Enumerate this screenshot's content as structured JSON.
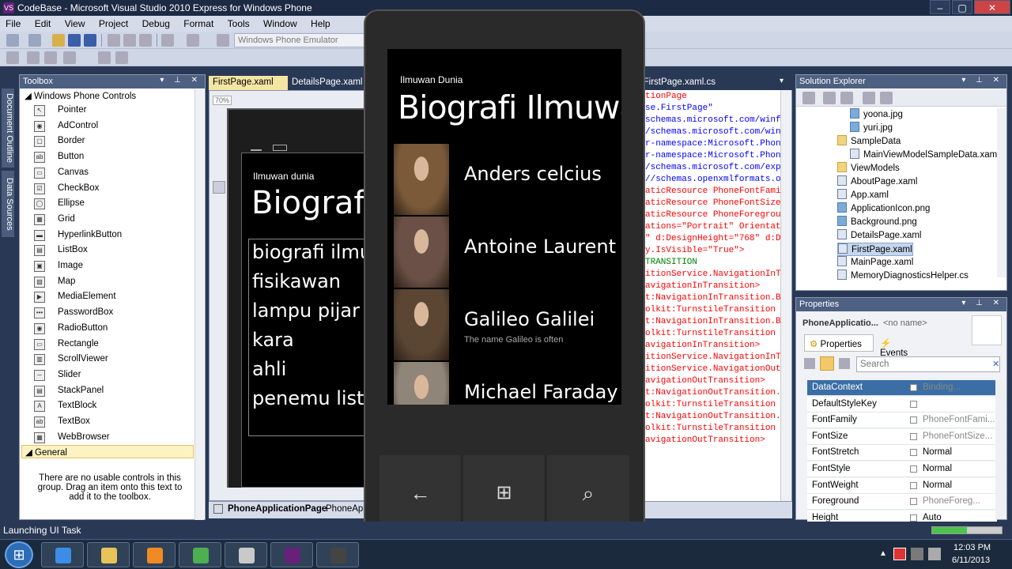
{
  "window": {
    "title": "CodeBase - Microsoft Visual Studio 2010 Express for Windows Phone",
    "app_icon": "visual-studio-icon"
  },
  "menu": [
    "File",
    "Edit",
    "View",
    "Project",
    "Debug",
    "Format",
    "Tools",
    "Window",
    "Help"
  ],
  "toolbar": {
    "target_device": "Windows Phone Emulator"
  },
  "left_tabs": [
    "Document Outline",
    "Data Sources"
  ],
  "toolbox": {
    "title": "Toolbox",
    "group_controls": "Windows Phone Controls",
    "items": [
      "Pointer",
      "AdControl",
      "Border",
      "Button",
      "Canvas",
      "CheckBox",
      "Ellipse",
      "Grid",
      "HyperlinkButton",
      "ListBox",
      "Image",
      "Map",
      "MediaElement",
      "PasswordBox",
      "RadioButton",
      "Rectangle",
      "ScrollViewer",
      "Slider",
      "StackPanel",
      "TextBlock",
      "TextBox",
      "WebBrowser"
    ],
    "group_general": "General",
    "general_empty_text": "There are no usable controls in this group. Drag an item onto this text to add it to the toolbox."
  },
  "doc_tabs": [
    "FirstPage.xaml",
    "DetailsPage.xaml",
    "FirstPage.xaml.cs"
  ],
  "designer": {
    "zoom": "70%",
    "app_title": "Ilmuwan dunia",
    "page_title": "Biografi",
    "list": [
      "biografi ilmu",
      "fisikawan",
      "lampu pijar",
      "kara",
      "ahli",
      "penemu list"
    ],
    "breadcrumb_root": "PhoneApplicationPage",
    "breadcrumb_next": "PhoneApp"
  },
  "xaml_lines": [
    {
      "t": "tionPage",
      "c": "red"
    },
    {
      "t": "se.FirstPage\"",
      "c": "blue"
    },
    {
      "t": "schemas.microsoft.com/winfx/",
      "c": "blue"
    },
    {
      "t": "/schemas.microsoft.com/winf",
      "c": "blue"
    },
    {
      "t": "r-namespace:Microsoft.Phone",
      "c": "blue"
    },
    {
      "t": "r-namespace:Microsoft.Phone",
      "c": "blue"
    },
    {
      "t": "/schemas.microsoft.com/exp",
      "c": "blue"
    },
    {
      "t": "//schemas.openxmlformats.o",
      "c": "blue"
    },
    {
      "t": "aticResource PhoneFontFami",
      "c": "red"
    },
    {
      "t": "aticResource PhoneFontSizeNo",
      "c": "red"
    },
    {
      "t": "aticResource PhoneForegrou",
      "c": "red"
    },
    {
      "t": "ations=\"Portrait\" Orientat",
      "c": "red"
    },
    {
      "t": "\" d:DesignHeight=\"768\" d:De",
      "c": "red"
    },
    {
      "t": "y.IsVisible=\"True\">",
      "c": "red"
    },
    {
      "t": " TRANSITION",
      "c": "green"
    },
    {
      "t": "itionService.NavigationInTra",
      "c": "red"
    },
    {
      "t": "avigationInTransition>",
      "c": "red"
    },
    {
      "t": "t:NavigationInTransition.Ba",
      "c": "red"
    },
    {
      "t": "olkit:TurnstileTransition M",
      "c": "red"
    },
    {
      "t": "t:NavigationInTransition.Ba",
      "c": "red"
    },
    {
      "t": "olkit:TurnstileTransition M",
      "c": "red"
    },
    {
      "t": "avigationInTransition>",
      "c": "red"
    },
    {
      "t": "itionService.NavigationInTra",
      "c": "red"
    },
    {
      "t": "itionService.NavigationOutTr",
      "c": "red"
    },
    {
      "t": "avigationOutTransition>",
      "c": "red"
    },
    {
      "t": "t:NavigationOutTransition.B",
      "c": "red"
    },
    {
      "t": "olkit:TurnstileTransition M",
      "c": "red"
    },
    {
      "t": "t:NavigationOutTransition.B",
      "c": "red"
    },
    {
      "t": "olkit:TurnstileTransition M",
      "c": "red"
    },
    {
      "t": "avigationOutTransition>",
      "c": "red"
    }
  ],
  "solution_explorer": {
    "title": "Solution Explorer",
    "items": [
      {
        "label": "yoona.jpg",
        "type": "img",
        "indent": 3
      },
      {
        "label": "yuri.jpg",
        "type": "img",
        "indent": 3
      },
      {
        "label": "SampleData",
        "type": "folder",
        "indent": 2
      },
      {
        "label": "MainViewModelSampleData.xaml",
        "type": "file",
        "indent": 3
      },
      {
        "label": "ViewModels",
        "type": "folder",
        "indent": 2
      },
      {
        "label": "AboutPage.xaml",
        "type": "file",
        "indent": 2
      },
      {
        "label": "App.xaml",
        "type": "file",
        "indent": 2
      },
      {
        "label": "ApplicationIcon.png",
        "type": "img",
        "indent": 2
      },
      {
        "label": "Background.png",
        "type": "img",
        "indent": 2
      },
      {
        "label": "DetailsPage.xaml",
        "type": "file",
        "indent": 2
      },
      {
        "label": "FirstPage.xaml",
        "type": "file",
        "indent": 2,
        "selected": true
      },
      {
        "label": "MainPage.xaml",
        "type": "file",
        "indent": 2
      },
      {
        "label": "MemoryDiagnosticsHelper.cs",
        "type": "file",
        "indent": 2
      }
    ]
  },
  "properties": {
    "title": "Properties",
    "object_type": "PhoneApplicatio...",
    "object_name": "<no name>",
    "tab_properties": "Properties",
    "tab_events": "Events",
    "search_placeholder": "Search",
    "rows": [
      {
        "name": "DataContext",
        "value": "Binding...",
        "selected": true
      },
      {
        "name": "DefaultStyleKey",
        "value": ""
      },
      {
        "name": "FontFamily",
        "value": "PhoneFontFami..."
      },
      {
        "name": "FontSize",
        "value": "PhoneFontSize..."
      },
      {
        "name": "FontStretch",
        "value": "Normal",
        "normal": true
      },
      {
        "name": "FontStyle",
        "value": "Normal",
        "normal": true
      },
      {
        "name": "FontWeight",
        "value": "Normal",
        "normal": true
      },
      {
        "name": "Foreground",
        "value": "PhoneForeg..."
      },
      {
        "name": "Height",
        "value": "Auto",
        "normal": true
      }
    ]
  },
  "phone": {
    "app_title": "Ilmuwan Dunia",
    "page_title": "Biografi Ilmuwan",
    "items": [
      {
        "name": "Anders celcius",
        "desc": "",
        "portrait_color": "#7b5a3a"
      },
      {
        "name": "Antoine Laurent",
        "desc": "",
        "portrait_color": "#6a5046"
      },
      {
        "name": "Galileo Galilei",
        "desc": "The name Galileo is often",
        "portrait_color": "#5b4634"
      },
      {
        "name": "Michael Faraday",
        "desc": "",
        "portrait_color": "#8f8578"
      }
    ],
    "appbar_button": "refresh-icon",
    "appbar_more": "...",
    "hw_buttons": [
      "back-icon",
      "windows-start-icon",
      "search-icon"
    ]
  },
  "status": {
    "text": "Launching UI Task"
  },
  "taskbar": {
    "time": "12:03 PM",
    "date": "6/11/2013",
    "apps": [
      "internet-explorer-icon",
      "file-explorer-icon",
      "media-player-icon",
      "chrome-icon",
      "folder-icon",
      "visual-studio-icon",
      "phone-emulator-icon"
    ]
  }
}
